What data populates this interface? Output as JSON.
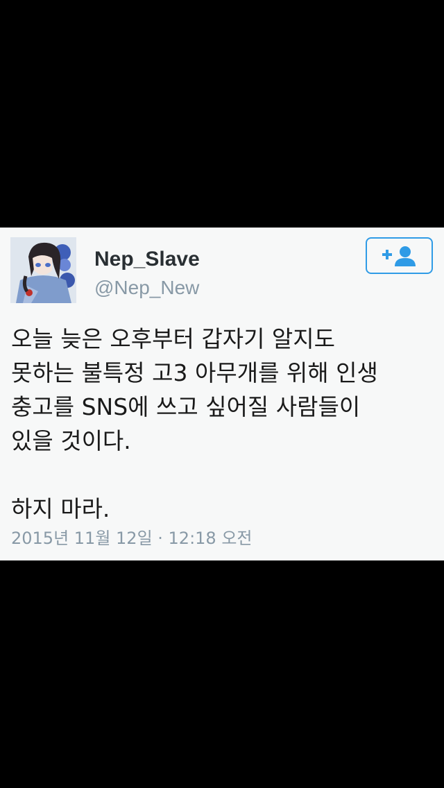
{
  "user": {
    "display_name": "Nep_Slave",
    "handle": "@Nep_New"
  },
  "follow_button": {
    "icon": "add-user-icon",
    "color": "#2f9be6"
  },
  "tweet": {
    "lines": [
      "오늘 늦은 오후부터 갑자기 알지도",
      "못하는 불특정 고3 아무개를 위해 인생",
      "충고를 SNS에 쓰고 싶어질 사람들이",
      "있을 것이다.",
      "하지 마라."
    ],
    "timestamp": "2015년 11월 12일 · 12:18 오전"
  },
  "colors": {
    "background": "#000000",
    "card": "#f7f8f8",
    "text": "#1a1a1a",
    "muted": "#8899a6",
    "accent": "#2f9be6"
  }
}
